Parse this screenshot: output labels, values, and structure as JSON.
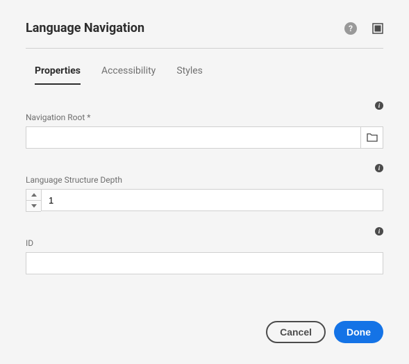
{
  "header": {
    "title": "Language Navigation"
  },
  "tabs": {
    "properties": "Properties",
    "accessibility": "Accessibility",
    "styles": "Styles"
  },
  "fields": {
    "navigation_root_label": "Navigation Root *",
    "navigation_root_value": "",
    "depth_label": "Language Structure Depth",
    "depth_value": "1",
    "id_label": "ID",
    "id_value": ""
  },
  "buttons": {
    "cancel": "Cancel",
    "done": "Done"
  }
}
